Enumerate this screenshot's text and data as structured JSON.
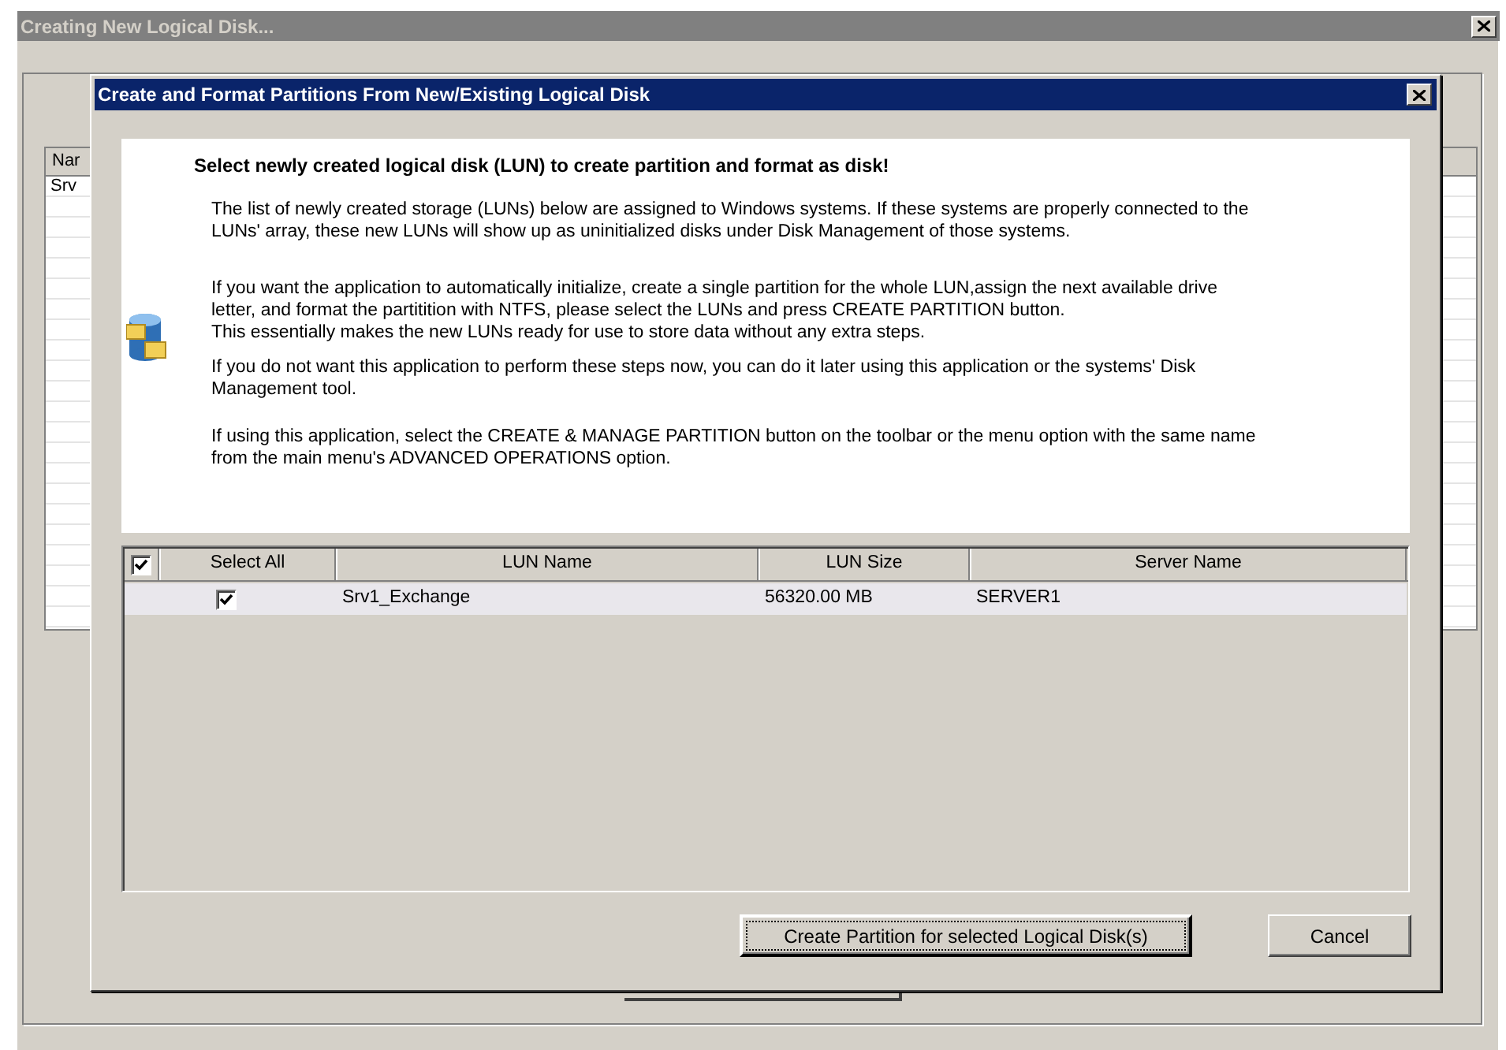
{
  "window": {
    "title": "Creating New Logical Disk..."
  },
  "background_list": {
    "column_1": "Nar",
    "rows": [
      "Srv"
    ]
  },
  "dialog": {
    "title": "Create and Format Partitions From New/Existing Logical Disk",
    "heading": "Select newly created logical disk (LUN) to create partition and format as disk!",
    "paragraphs": [
      "The list of newly created storage (LUNs) below are assigned to Windows systems. If these systems are properly connected to the\nLUNs' array, these new LUNs will show up as uninitialized disks under Disk Management of those systems.",
      "If you want the application to automatically initialize, create a single partition for the whole LUN,assign the next available drive\nletter, and format the partitition with NTFS, please select the LUNs and press CREATE PARTITION button.\nThis essentially makes the new LUNs ready for use to store data without any extra steps.",
      "If you do not want this application to perform these steps now, you can do it later using this application or the systems' Disk\nManagement tool.",
      "If using this application, select the CREATE & MANAGE PARTITION button on the toolbar or the menu option with the same name\nfrom the main menu's ADVANCED OPERATIONS option."
    ],
    "table": {
      "select_all_checked": true,
      "columns": [
        "Select All",
        "LUN Name",
        "LUN Size",
        "Server Name"
      ],
      "rows": [
        {
          "checked": true,
          "lun_name": "Srv1_Exchange",
          "lun_size": "56320.00 MB",
          "server_name": "SERVER1"
        }
      ]
    },
    "buttons": [
      {
        "label": "Create Partition for selected Logical Disk(s)",
        "default": true
      },
      {
        "label": "Cancel",
        "default": false
      }
    ]
  }
}
